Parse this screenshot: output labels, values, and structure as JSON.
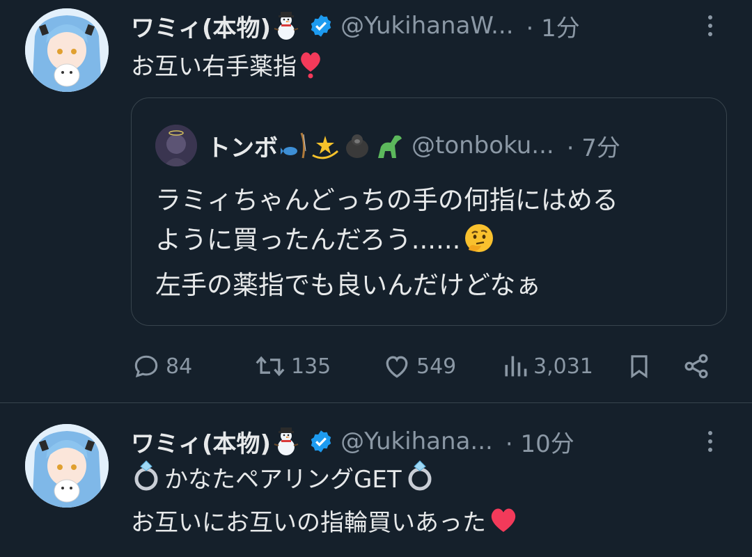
{
  "tweets": [
    {
      "author_name": "ワミィ(本物)",
      "author_handle": "@YukihanaW...",
      "time": "· 1分",
      "text_line1": "お互い右手薬指",
      "quote": {
        "author_name": "トンボ",
        "author_handle": "@tonboku...",
        "time": "· 7分",
        "lines": [
          "ラミィちゃんどっちの手の何指にはめる",
          "ように買ったんだろう......",
          "左手の薬指でも良いんだけどなぁ"
        ]
      },
      "stats": {
        "replies": "84",
        "reposts": "135",
        "likes": "549",
        "views": "3,031"
      }
    },
    {
      "author_name": "ワミィ(本物)",
      "author_handle": "@Yukihana...",
      "time": "· 10分",
      "lines": [
        "かなたペアリングGET",
        "お互いにお互いの指輪買いあった"
      ]
    }
  ],
  "colors": {
    "background": "#15202b",
    "text": "#e7e9ea",
    "secondary": "#8b98a5",
    "verified": "#1d9bf0",
    "border": "#38444d"
  },
  "icons": [
    "more-icon",
    "verified-icon",
    "snowman-emoji",
    "heart-emoji",
    "ring-emoji",
    "thinking-emoji",
    "reply-icon",
    "repost-icon",
    "like-icon",
    "views-icon",
    "bookmark-icon",
    "share-icon"
  ]
}
